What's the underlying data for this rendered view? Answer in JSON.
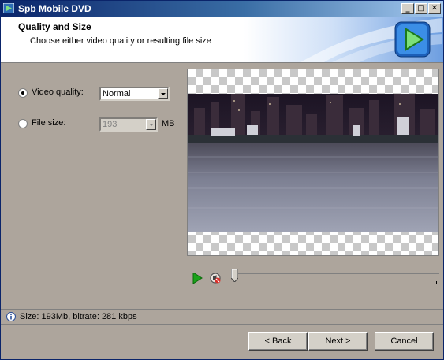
{
  "window": {
    "title": "Spb Mobile DVD",
    "controls": {
      "minimize": "_",
      "maximize": "□",
      "close": "✕"
    }
  },
  "header": {
    "title": "Quality and Size",
    "subtitle": "Choose either video quality or resulting file size"
  },
  "options": {
    "video_quality": {
      "label": "Video quality:",
      "selected": true,
      "value": "Normal"
    },
    "file_size": {
      "label": "File size:",
      "selected": false,
      "value": "193",
      "unit": "MB"
    }
  },
  "player": {
    "play_icon": "play-icon",
    "mute_icon": "mute-icon",
    "position": 0
  },
  "status": {
    "text": "Size: 193Mb, bitrate: 281 kbps"
  },
  "buttons": {
    "back": "< Back",
    "next": "Next >",
    "cancel": "Cancel"
  },
  "colors": {
    "title_bar": "#0a246a",
    "panel": "#ada59c",
    "play_green": "#1aa21a"
  }
}
